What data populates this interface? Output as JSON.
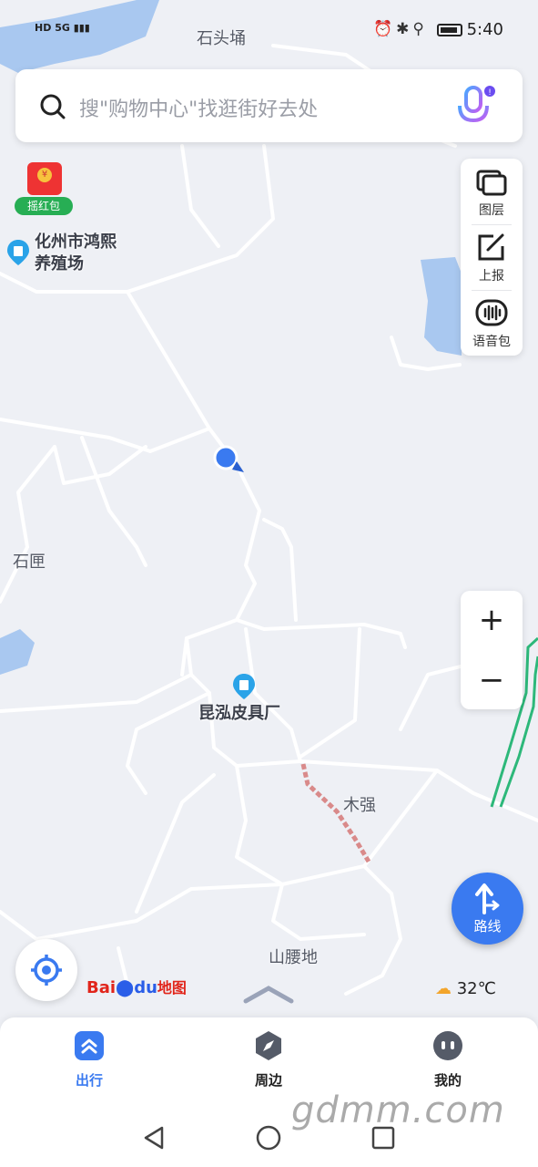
{
  "status": {
    "hd": "HD",
    "net": "5G",
    "time": "5:40"
  },
  "search": {
    "placeholder": "搜\"购物中心\"找逛街好去处"
  },
  "red_packet": {
    "label": "摇红包"
  },
  "tools": [
    {
      "label": "图层"
    },
    {
      "label": "上报"
    },
    {
      "label": "语音包"
    }
  ],
  "zoom": {
    "in": "+",
    "out": "−"
  },
  "map": {
    "places": {
      "shitoutan": "石头埇",
      "shiyan": "石匣",
      "muqiang": "木强",
      "shanyaodi": "山腰地"
    },
    "pois": {
      "farm": "化州市鸿熙\n养殖场",
      "factory": "昆泓皮具厂"
    }
  },
  "route": {
    "label": "路线"
  },
  "logo": {
    "a": "Bai",
    "b": "du",
    "c": "地图"
  },
  "weather": {
    "temp": "32℃"
  },
  "bottom_nav": [
    {
      "label": "出行",
      "active": true
    },
    {
      "label": "周边"
    },
    {
      "label": "我的"
    }
  ],
  "watermark": "gdmm.com",
  "colors": {
    "accent": "#3a7af0",
    "water": "#a9c8f0",
    "road": "#ffffff",
    "rail": "#2db87a"
  }
}
